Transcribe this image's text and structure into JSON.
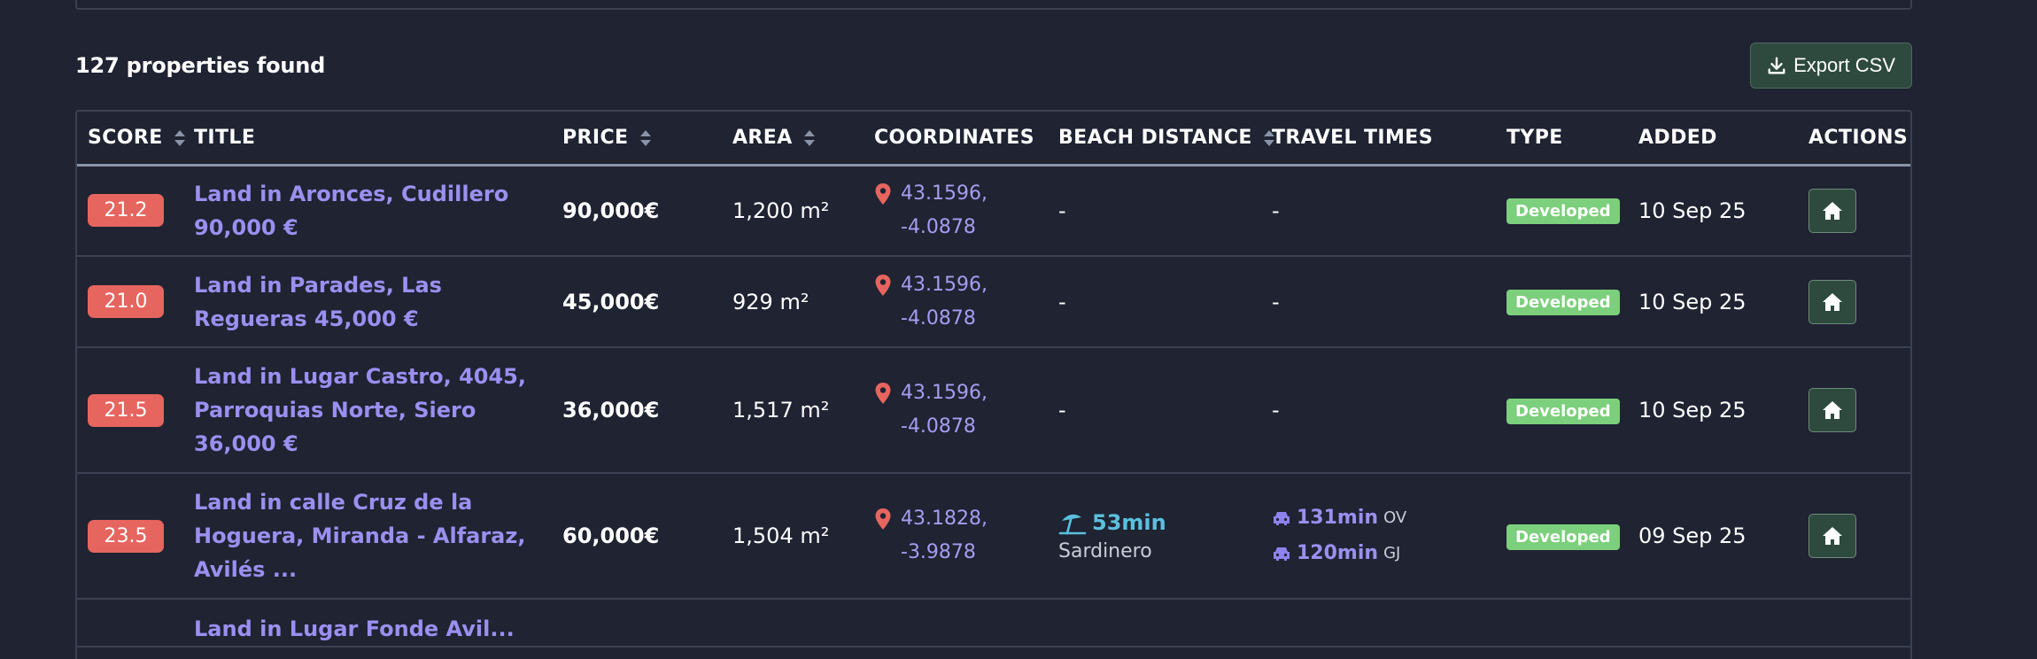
{
  "results": {
    "count_label": "127 properties found",
    "export_label": "Export CSV"
  },
  "table": {
    "headers": {
      "score": "SCORE",
      "title": "TITLE",
      "price": "PRICE",
      "area": "AREA",
      "coordinates": "COORDINATES",
      "beach_distance": "BEACH DISTANCE",
      "travel_times": "TRAVEL TIMES",
      "type": "TYPE",
      "added": "ADDED",
      "actions": "ACTIONS"
    },
    "rows": [
      {
        "score": "21.2",
        "title": "Land in Aronces, Cudillero 90,000 €",
        "price": "90,000€",
        "area": "1,200 m²",
        "lat": "43.1596,",
        "lon": "-4.0878",
        "beach": "-",
        "travel": "-",
        "type": "Developed",
        "added": "10 Sep 25"
      },
      {
        "score": "21.0",
        "title": "Land in Parades, Las Regueras 45,000 €",
        "price": "45,000€",
        "area": "929 m²",
        "lat": "43.1596,",
        "lon": "-4.0878",
        "beach": "-",
        "travel": "-",
        "type": "Developed",
        "added": "10 Sep 25"
      },
      {
        "score": "21.5",
        "title": "Land in Lugar Castro, 4045, Parroquias Norte, Siero 36,000 €",
        "price": "36,000€",
        "area": "1,517 m²",
        "lat": "43.1596,",
        "lon": "-4.0878",
        "beach": "-",
        "travel": "-",
        "type": "Developed",
        "added": "10 Sep 25"
      },
      {
        "score": "23.5",
        "title": "Land in calle Cruz de la Hoguera, Miranda - Alfaraz, Avilés ...",
        "price": "60,000€",
        "area": "1,504 m²",
        "lat": "43.1828,",
        "lon": "-3.9878",
        "beach_time": "53min",
        "beach_name": "Sardinero",
        "travel_1_time": "131min",
        "travel_1_dest": "OV",
        "travel_2_time": "120min",
        "travel_2_dest": "GJ",
        "type": "Developed",
        "added": "09 Sep 25"
      },
      {
        "title": "Land in Lugar Fonde Avil..."
      }
    ]
  },
  "colors": {
    "background": "#1f2332",
    "accent_link": "#9b8ff0",
    "score_badge": "#e6655e",
    "type_badge": "#7ccf7c",
    "beach": "#5bc0de",
    "button_bg": "#2e4a3e"
  },
  "icons": {
    "download": "download-icon",
    "sort": "sort-icon",
    "pin": "map-pin-icon",
    "beach": "beach-umbrella-icon",
    "car": "car-icon",
    "home": "home-icon"
  }
}
